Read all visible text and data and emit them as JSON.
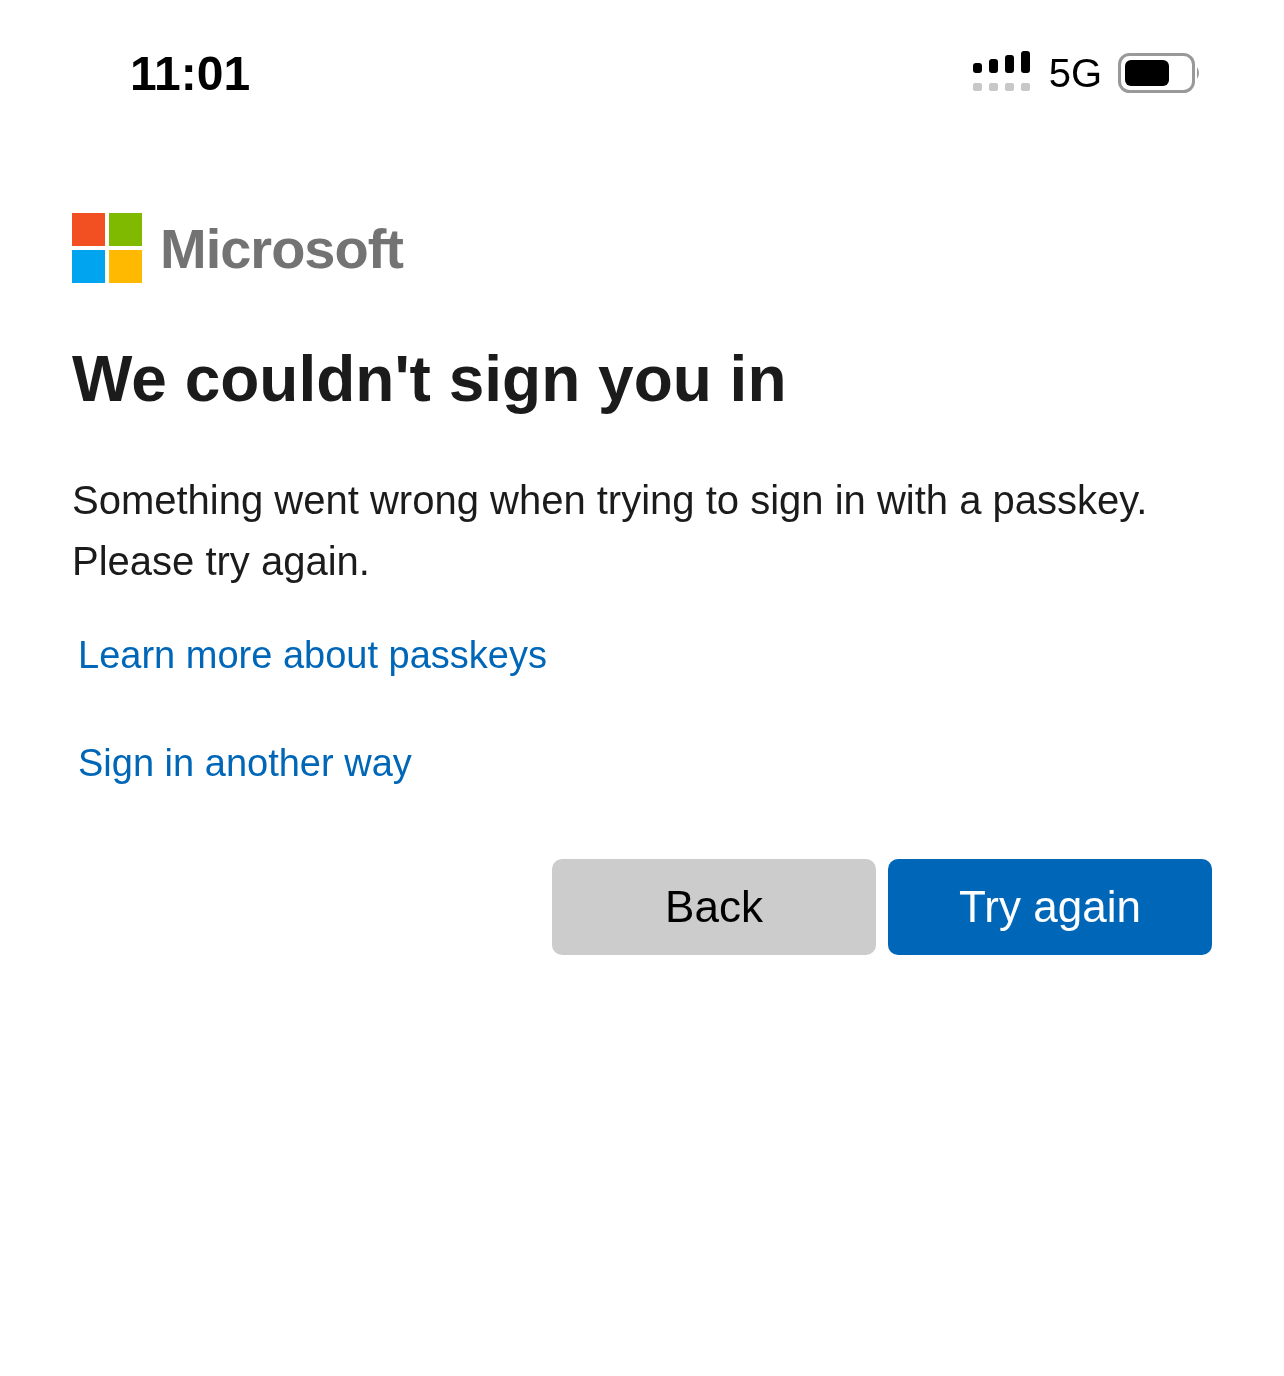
{
  "status_bar": {
    "time": "11:01",
    "network": "5G"
  },
  "brand": {
    "name": "Microsoft"
  },
  "title": "We couldn't sign you in",
  "message": "Something went wrong when trying to sign in with a passkey. Please try again.",
  "links": [
    "Learn more about passkeys",
    "Sign in another way"
  ],
  "buttons": [
    {
      "label": "Back",
      "kind": "secondary"
    },
    {
      "label": "Try again",
      "kind": "primary"
    }
  ]
}
